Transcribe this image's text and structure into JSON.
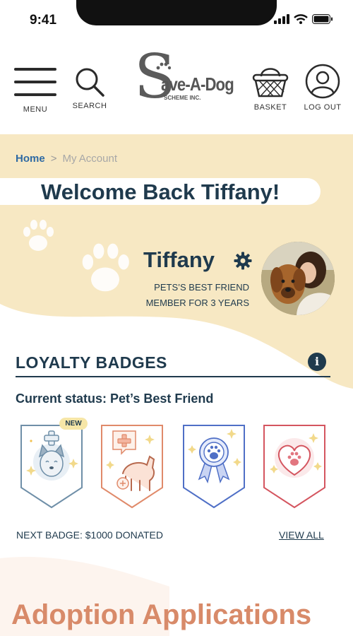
{
  "status_bar": {
    "time": "9:41"
  },
  "header": {
    "menu_label": "MENU",
    "search_label": "SEARCH",
    "logo_text": "ave-A-Dog",
    "logo_initial": "S",
    "logo_sub": "SCHEME INC.",
    "basket_label": "BASKET",
    "logout_label": "LOG OUT"
  },
  "breadcrumb": {
    "home": "Home",
    "separator": ">",
    "current": "My Account"
  },
  "welcome": "Welcome Back Tiffany!",
  "profile": {
    "name": "Tiffany",
    "title": "PETS’S BEST FRIEND",
    "member": "MEMBER FOR 3 YEARS"
  },
  "loyalty": {
    "title": "LOYALTY BADGES",
    "info": "i",
    "current_status": "Current status: Pet’s Best Friend",
    "new_tag": "NEW",
    "next_badge": "NEXT BADGE: $1000 DONATED",
    "view_all": "VIEW ALL",
    "badges": [
      {
        "icon": "dog-health-icon",
        "border": "#6f8fa8"
      },
      {
        "icon": "dog-vet-icon",
        "border": "#e08a6a"
      },
      {
        "icon": "paw-ribbon-icon",
        "border": "#4f6fc6"
      },
      {
        "icon": "paw-heart-icon",
        "border": "#d4555f"
      }
    ]
  },
  "adoption": {
    "title": "Adoption Applications"
  },
  "colors": {
    "navy": "#1f3a4d",
    "cream": "#f7e8c3",
    "accent": "#d88a69",
    "link": "#2f6aa3"
  }
}
